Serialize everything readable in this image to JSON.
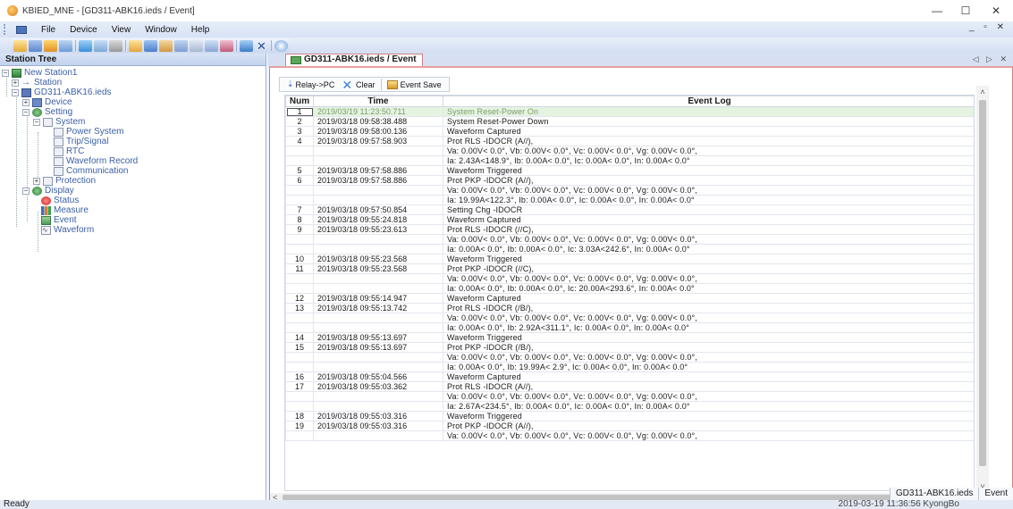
{
  "window": {
    "title": "KBIED_MNE - [GD311-ABK16.ieds / Event]",
    "controls": {
      "minimize": "—",
      "maximize": "☐",
      "close": "✕"
    }
  },
  "menu": {
    "items": [
      "File",
      "Device",
      "View",
      "Window",
      "Help"
    ],
    "right_controls": "_ ▫ ✕"
  },
  "toolbar": {
    "buttons": [
      "open-icon",
      "save-icon",
      "connect-icon",
      "disconnect-icon",
      "upload-icon",
      "download-icon",
      "settings-icon",
      "monitor-icon",
      "waveform-icon",
      "event-icon",
      "log-icon",
      "trend-icon",
      "chart-icon",
      "export-icon",
      "delete-icon",
      "help-icon"
    ]
  },
  "station_tree": {
    "header": "Station Tree",
    "nodes": {
      "root": "New Station1",
      "station": "Station",
      "device": "GD311-ABK16.ieds",
      "device_sub": "Device",
      "setting": "Setting",
      "system": "System",
      "power_system": "Power System",
      "trip_signal": "Trip/Signal",
      "rtc": "RTC",
      "waveform_record": "Waveform Record",
      "communication": "Communication",
      "protection": "Protection",
      "display": "Display",
      "status": "Status",
      "measure": "Measure",
      "event": "Event",
      "waveform": "Waveform"
    }
  },
  "document": {
    "tab_title": "GD311-ABK16.ieds / Event",
    "tab_nav": "◁ ▷ ✕",
    "actions": {
      "relay_to_pc": "Relay->PC",
      "clear": "Clear",
      "event_save": "Event Save"
    },
    "columns": {
      "num": "Num",
      "time": "Time",
      "log": "Event Log"
    },
    "rows": [
      {
        "num": "1",
        "time": "2019/03/19 11:23:50.711",
        "log": "System Reset-Power On",
        "selected": true
      },
      {
        "num": "2",
        "time": "2019/03/18 09:58:38.488",
        "log": "System Reset-Power Down"
      },
      {
        "num": "3",
        "time": "2019/03/18 09:58:00.136",
        "log": "Waveform Captured"
      },
      {
        "num": "4",
        "time": "2019/03/18 09:57:58.903",
        "log": "Prot RLS -IDOCR (A//),"
      },
      {
        "num": "",
        "time": "",
        "log": "Va: 0.00V< 0.0°, Vb: 0.00V< 0.0°, Vc: 0.00V< 0.0°, Vg: 0.00V< 0.0°,"
      },
      {
        "num": "",
        "time": "",
        "log": "Ia: 2.43A<148.9°, Ib: 0.00A< 0.0°, Ic: 0.00A< 0.0°, In: 0.00A< 0.0°"
      },
      {
        "num": "5",
        "time": "2019/03/18 09:57:58.886",
        "log": "Waveform Triggered"
      },
      {
        "num": "6",
        "time": "2019/03/18 09:57:58.886",
        "log": "Prot PKP -IDOCR (A//),"
      },
      {
        "num": "",
        "time": "",
        "log": "Va: 0.00V< 0.0°, Vb: 0.00V< 0.0°, Vc: 0.00V< 0.0°, Vg: 0.00V< 0.0°,"
      },
      {
        "num": "",
        "time": "",
        "log": "Ia: 19.99A<122.3°, Ib: 0.00A< 0.0°, Ic: 0.00A< 0.0°, In: 0.00A< 0.0°"
      },
      {
        "num": "7",
        "time": "2019/03/18 09:57:50.854",
        "log": "Setting Chg -IDOCR"
      },
      {
        "num": "8",
        "time": "2019/03/18 09:55:24.818",
        "log": "Waveform Captured"
      },
      {
        "num": "9",
        "time": "2019/03/18 09:55:23.613",
        "log": "Prot RLS -IDOCR (//C),"
      },
      {
        "num": "",
        "time": "",
        "log": "Va: 0.00V< 0.0°, Vb: 0.00V< 0.0°, Vc: 0.00V< 0.0°, Vg: 0.00V< 0.0°,"
      },
      {
        "num": "",
        "time": "",
        "log": "Ia: 0.00A< 0.0°, Ib: 0.00A< 0.0°, Ic: 3.03A<242.6°, In: 0.00A< 0.0°"
      },
      {
        "num": "10",
        "time": "2019/03/18 09:55:23.568",
        "log": "Waveform Triggered"
      },
      {
        "num": "11",
        "time": "2019/03/18 09:55:23.568",
        "log": "Prot PKP -IDOCR (//C),"
      },
      {
        "num": "",
        "time": "",
        "log": "Va: 0.00V< 0.0°, Vb: 0.00V< 0.0°, Vc: 0.00V< 0.0°, Vg: 0.00V< 0.0°,"
      },
      {
        "num": "",
        "time": "",
        "log": "Ia: 0.00A< 0.0°, Ib: 0.00A< 0.0°, Ic: 20.00A<293.6°, In: 0.00A< 0.0°"
      },
      {
        "num": "12",
        "time": "2019/03/18 09:55:14.947",
        "log": "Waveform Captured"
      },
      {
        "num": "13",
        "time": "2019/03/18 09:55:13.742",
        "log": "Prot RLS -IDOCR (/B/),"
      },
      {
        "num": "",
        "time": "",
        "log": "Va: 0.00V< 0.0°, Vb: 0.00V< 0.0°, Vc: 0.00V< 0.0°, Vg: 0.00V< 0.0°,"
      },
      {
        "num": "",
        "time": "",
        "log": "Ia: 0.00A< 0.0°, Ib: 2.92A<311.1°, Ic: 0.00A< 0.0°, In: 0.00A< 0.0°"
      },
      {
        "num": "14",
        "time": "2019/03/18 09:55:13.697",
        "log": "Waveform Triggered"
      },
      {
        "num": "15",
        "time": "2019/03/18 09:55:13.697",
        "log": "Prot PKP -IDOCR (/B/),"
      },
      {
        "num": "",
        "time": "",
        "log": "Va: 0.00V< 0.0°, Vb: 0.00V< 0.0°, Vc: 0.00V< 0.0°, Vg: 0.00V< 0.0°,"
      },
      {
        "num": "",
        "time": "",
        "log": "Ia: 0.00A< 0.0°, Ib: 19.99A< 2.9°, Ic: 0.00A< 0.0°, In: 0.00A< 0.0°"
      },
      {
        "num": "16",
        "time": "2019/03/18 09:55:04.566",
        "log": "Waveform Captured"
      },
      {
        "num": "17",
        "time": "2019/03/18 09:55:03.362",
        "log": "Prot RLS -IDOCR (A//),"
      },
      {
        "num": "",
        "time": "",
        "log": "Va: 0.00V< 0.0°, Vb: 0.00V< 0.0°, Vc: 0.00V< 0.0°, Vg: 0.00V< 0.0°,"
      },
      {
        "num": "",
        "time": "",
        "log": "Ia: 2.67A<234.5°, Ib: 0.00A< 0.0°, Ic: 0.00A< 0.0°, In: 0.00A< 0.0°"
      },
      {
        "num": "18",
        "time": "2019/03/18 09:55:03.316",
        "log": "Waveform Triggered"
      },
      {
        "num": "19",
        "time": "2019/03/18 09:55:03.316",
        "log": "Prot PKP -IDOCR (A//),"
      },
      {
        "num": "",
        "time": "",
        "log": "Va: 0.00V< 0.0°, Vb: 0.00V< 0.0°, Vc: 0.00V< 0.0°, Vg: 0.00V< 0.0°,"
      }
    ],
    "bottom_tabs": [
      "GD311-ABK16.ieds",
      "Event"
    ]
  },
  "statusbar": {
    "left": "Ready",
    "right": "2019-03-19 11:36:56  KyongBo"
  },
  "colors": {
    "selected_row_bg": "#e4f4e1",
    "selected_row_text": "#7d9b6a",
    "tree_text": "#3a5fa6",
    "accent_border": "#d08080"
  }
}
